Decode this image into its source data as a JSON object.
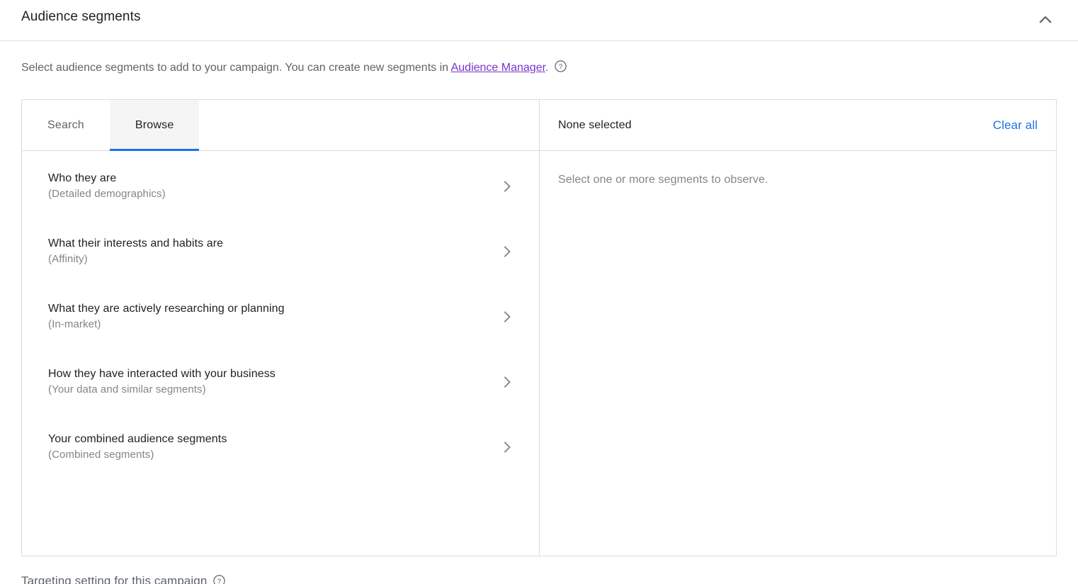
{
  "card": {
    "title": "Audience segments",
    "collapse_icon": "chevron-up-icon"
  },
  "description": {
    "text_before": "Select audience segments to add to your campaign. You can create new segments in ",
    "link_label": "Audience Manager",
    "text_after": ".",
    "help_icon": "help-circle-icon",
    "link_color": "#7b34c9"
  },
  "tabs": [
    {
      "label": "Search",
      "active": false
    },
    {
      "label": "Browse",
      "active": true
    }
  ],
  "selection": {
    "count_label": "None selected",
    "clear_all_label": "Clear all",
    "empty_message": "Select one or more segments to observe.",
    "clear_all_color": "#1a73e8"
  },
  "categories": [
    {
      "title": "Who they are",
      "subtitle": "(Detailed demographics)",
      "chevron_icon": "chevron-right-icon"
    },
    {
      "title": "What their interests and habits are",
      "subtitle": "(Affinity)",
      "chevron_icon": "chevron-right-icon"
    },
    {
      "title": "What they are actively researching or planning",
      "subtitle": "(In-market)",
      "chevron_icon": "chevron-right-icon"
    },
    {
      "title": "How they have interacted with your business",
      "subtitle": "(Your data and similar segments)",
      "chevron_icon": "chevron-right-icon"
    },
    {
      "title": "Your combined audience segments",
      "subtitle": "(Combined segments)",
      "chevron_icon": "chevron-right-icon"
    }
  ],
  "footer": {
    "text": "Targeting setting for this campaign",
    "help_icon": "help-circle-icon"
  },
  "theme": {
    "accent_blue": "#1a73e8",
    "border": "#dadce0",
    "text_primary": "#202124",
    "text_secondary": "#5f6368",
    "text_muted": "#80868b",
    "active_tab_bg": "#f5f5f5"
  }
}
